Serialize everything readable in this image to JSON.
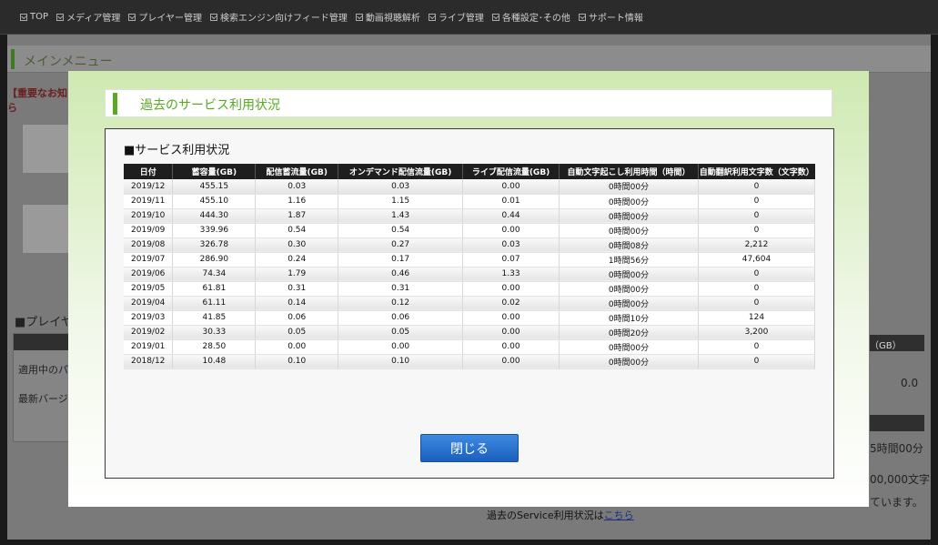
{
  "nav": {
    "items": [
      "TOP",
      "メディア管理",
      "プレイヤー管理",
      "検索エンジン向けフィード管理",
      "動画視聴解析",
      "ライブ管理",
      "各種設定･その他",
      "サポート情報"
    ]
  },
  "background": {
    "menu_title": "メインメニュー",
    "notice": "【重要なお知ら",
    "player_section": "■プレイヤ",
    "row_applied": "適用中のパ",
    "row_latest": "最新バージョ",
    "right_gb": "（GB）",
    "right_value": "0.0",
    "right_time": "5時間00分",
    "right_chars": "00,000文字",
    "right_tail": "ています。",
    "bottom_text": "過去のService利用状況は",
    "bottom_link": "こちら"
  },
  "modal": {
    "title": "過去のサービス利用状況",
    "panel_title": "■サービス利用状況",
    "close_label": "閉じる"
  },
  "table": {
    "headers": [
      "日付",
      "蓄容量(GB)",
      "配信蓄流量(GB)",
      "オンデマンド配信流量(GB)",
      "ライブ配信流量(GB)",
      "自動文字起こし利用時間（時間）",
      "自動翻訳利用文字数（文字数）"
    ],
    "rows": [
      [
        "2019/12",
        "455.15",
        "0.03",
        "0.03",
        "0.00",
        "0時間00分",
        "0"
      ],
      [
        "2019/11",
        "455.10",
        "1.16",
        "1.15",
        "0.01",
        "0時間00分",
        "0"
      ],
      [
        "2019/10",
        "444.30",
        "1.87",
        "1.43",
        "0.44",
        "0時間00分",
        "0"
      ],
      [
        "2019/09",
        "339.96",
        "0.54",
        "0.54",
        "0.00",
        "0時間00分",
        "0"
      ],
      [
        "2019/08",
        "326.78",
        "0.30",
        "0.27",
        "0.03",
        "0時間08分",
        "2,212"
      ],
      [
        "2019/07",
        "286.90",
        "0.24",
        "0.17",
        "0.07",
        "1時間56分",
        "47,604"
      ],
      [
        "2019/06",
        "74.34",
        "1.79",
        "0.46",
        "1.33",
        "0時間00分",
        "0"
      ],
      [
        "2019/05",
        "61.81",
        "0.31",
        "0.31",
        "0.00",
        "0時間00分",
        "0"
      ],
      [
        "2019/04",
        "61.11",
        "0.14",
        "0.12",
        "0.02",
        "0時間00分",
        "0"
      ],
      [
        "2019/03",
        "41.85",
        "0.06",
        "0.06",
        "0.00",
        "0時間10分",
        "124"
      ],
      [
        "2019/02",
        "30.33",
        "0.05",
        "0.05",
        "0.00",
        "0時間20分",
        "3,200"
      ],
      [
        "2019/01",
        "28.50",
        "0.00",
        "0.00",
        "0.00",
        "0時間00分",
        "0"
      ],
      [
        "2018/12",
        "10.48",
        "0.10",
        "0.10",
        "0.00",
        "0時間00分",
        "0"
      ]
    ]
  }
}
